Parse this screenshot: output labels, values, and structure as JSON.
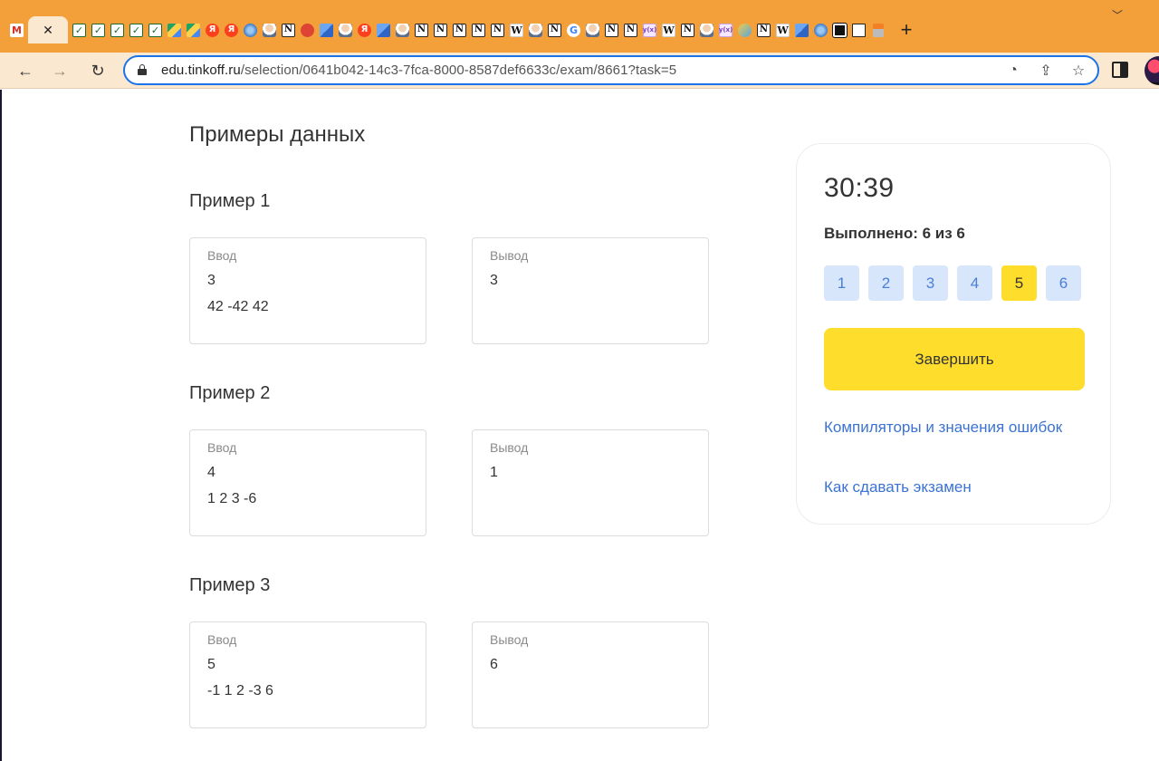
{
  "browser": {
    "tab_favicons": [
      "gmail-icon",
      "close-icon",
      "check-icon",
      "check-icon",
      "check-icon",
      "check-icon",
      "check-icon",
      "drive-icon",
      "drive-icon",
      "yandex-icon",
      "yandex-icon",
      "globe-icon",
      "avatar-icon",
      "notion-icon",
      "red-app-icon",
      "image-icon",
      "avatar-icon",
      "yandex-icon",
      "image-icon",
      "avatar-icon",
      "notion-icon",
      "notion-icon",
      "notion-icon",
      "notion-icon",
      "notion-icon",
      "wikipedia-icon",
      "avatar-icon",
      "notion-icon",
      "google-icon",
      "avatar-icon",
      "notion-icon",
      "notion-icon",
      "math-icon",
      "wikipedia-icon",
      "notion-icon",
      "avatar-icon",
      "math-icon",
      "puzzle-icon",
      "notion-icon",
      "wikipedia-icon",
      "image-icon",
      "globe-icon",
      "black-square-icon",
      "square-icon",
      "stack-icon"
    ],
    "gmail_letter": "M",
    "new_tab_label": "+",
    "url_host": "edu.tinkoff.ru",
    "url_path": "/selection/0641b042-14c3-7fca-8000-8587def6633c/exam/8661?task=5",
    "tab_bar_color": "#f4a03a",
    "toolbar_color": "#fbe8d0"
  },
  "content": {
    "section_title": "Примеры данных",
    "input_label": "Ввод",
    "output_label": "Вывод",
    "examples": [
      {
        "title": "Пример 1",
        "input": [
          "3",
          "42 -42 42"
        ],
        "output": [
          "3"
        ]
      },
      {
        "title": "Пример 2",
        "input": [
          "4",
          "1 2 3 -6"
        ],
        "output": [
          "1"
        ]
      },
      {
        "title": "Пример 3",
        "input": [
          "5",
          "-1 1 2 -3 6"
        ],
        "output": [
          "6"
        ]
      }
    ]
  },
  "panel": {
    "timer": "30:39",
    "done_text": "Выполнено: 6 из 6",
    "tasks": [
      "1",
      "2",
      "3",
      "4",
      "5",
      "6"
    ],
    "current_task": "5",
    "finish_label": "Завершить",
    "link_compilers": "Компиляторы и значения ошибок",
    "link_howto": "Как сдавать экзамен",
    "accent_yellow": "#ffdd2d",
    "link_color": "#3b73d3",
    "task_button_color": "#d8e6fb"
  }
}
